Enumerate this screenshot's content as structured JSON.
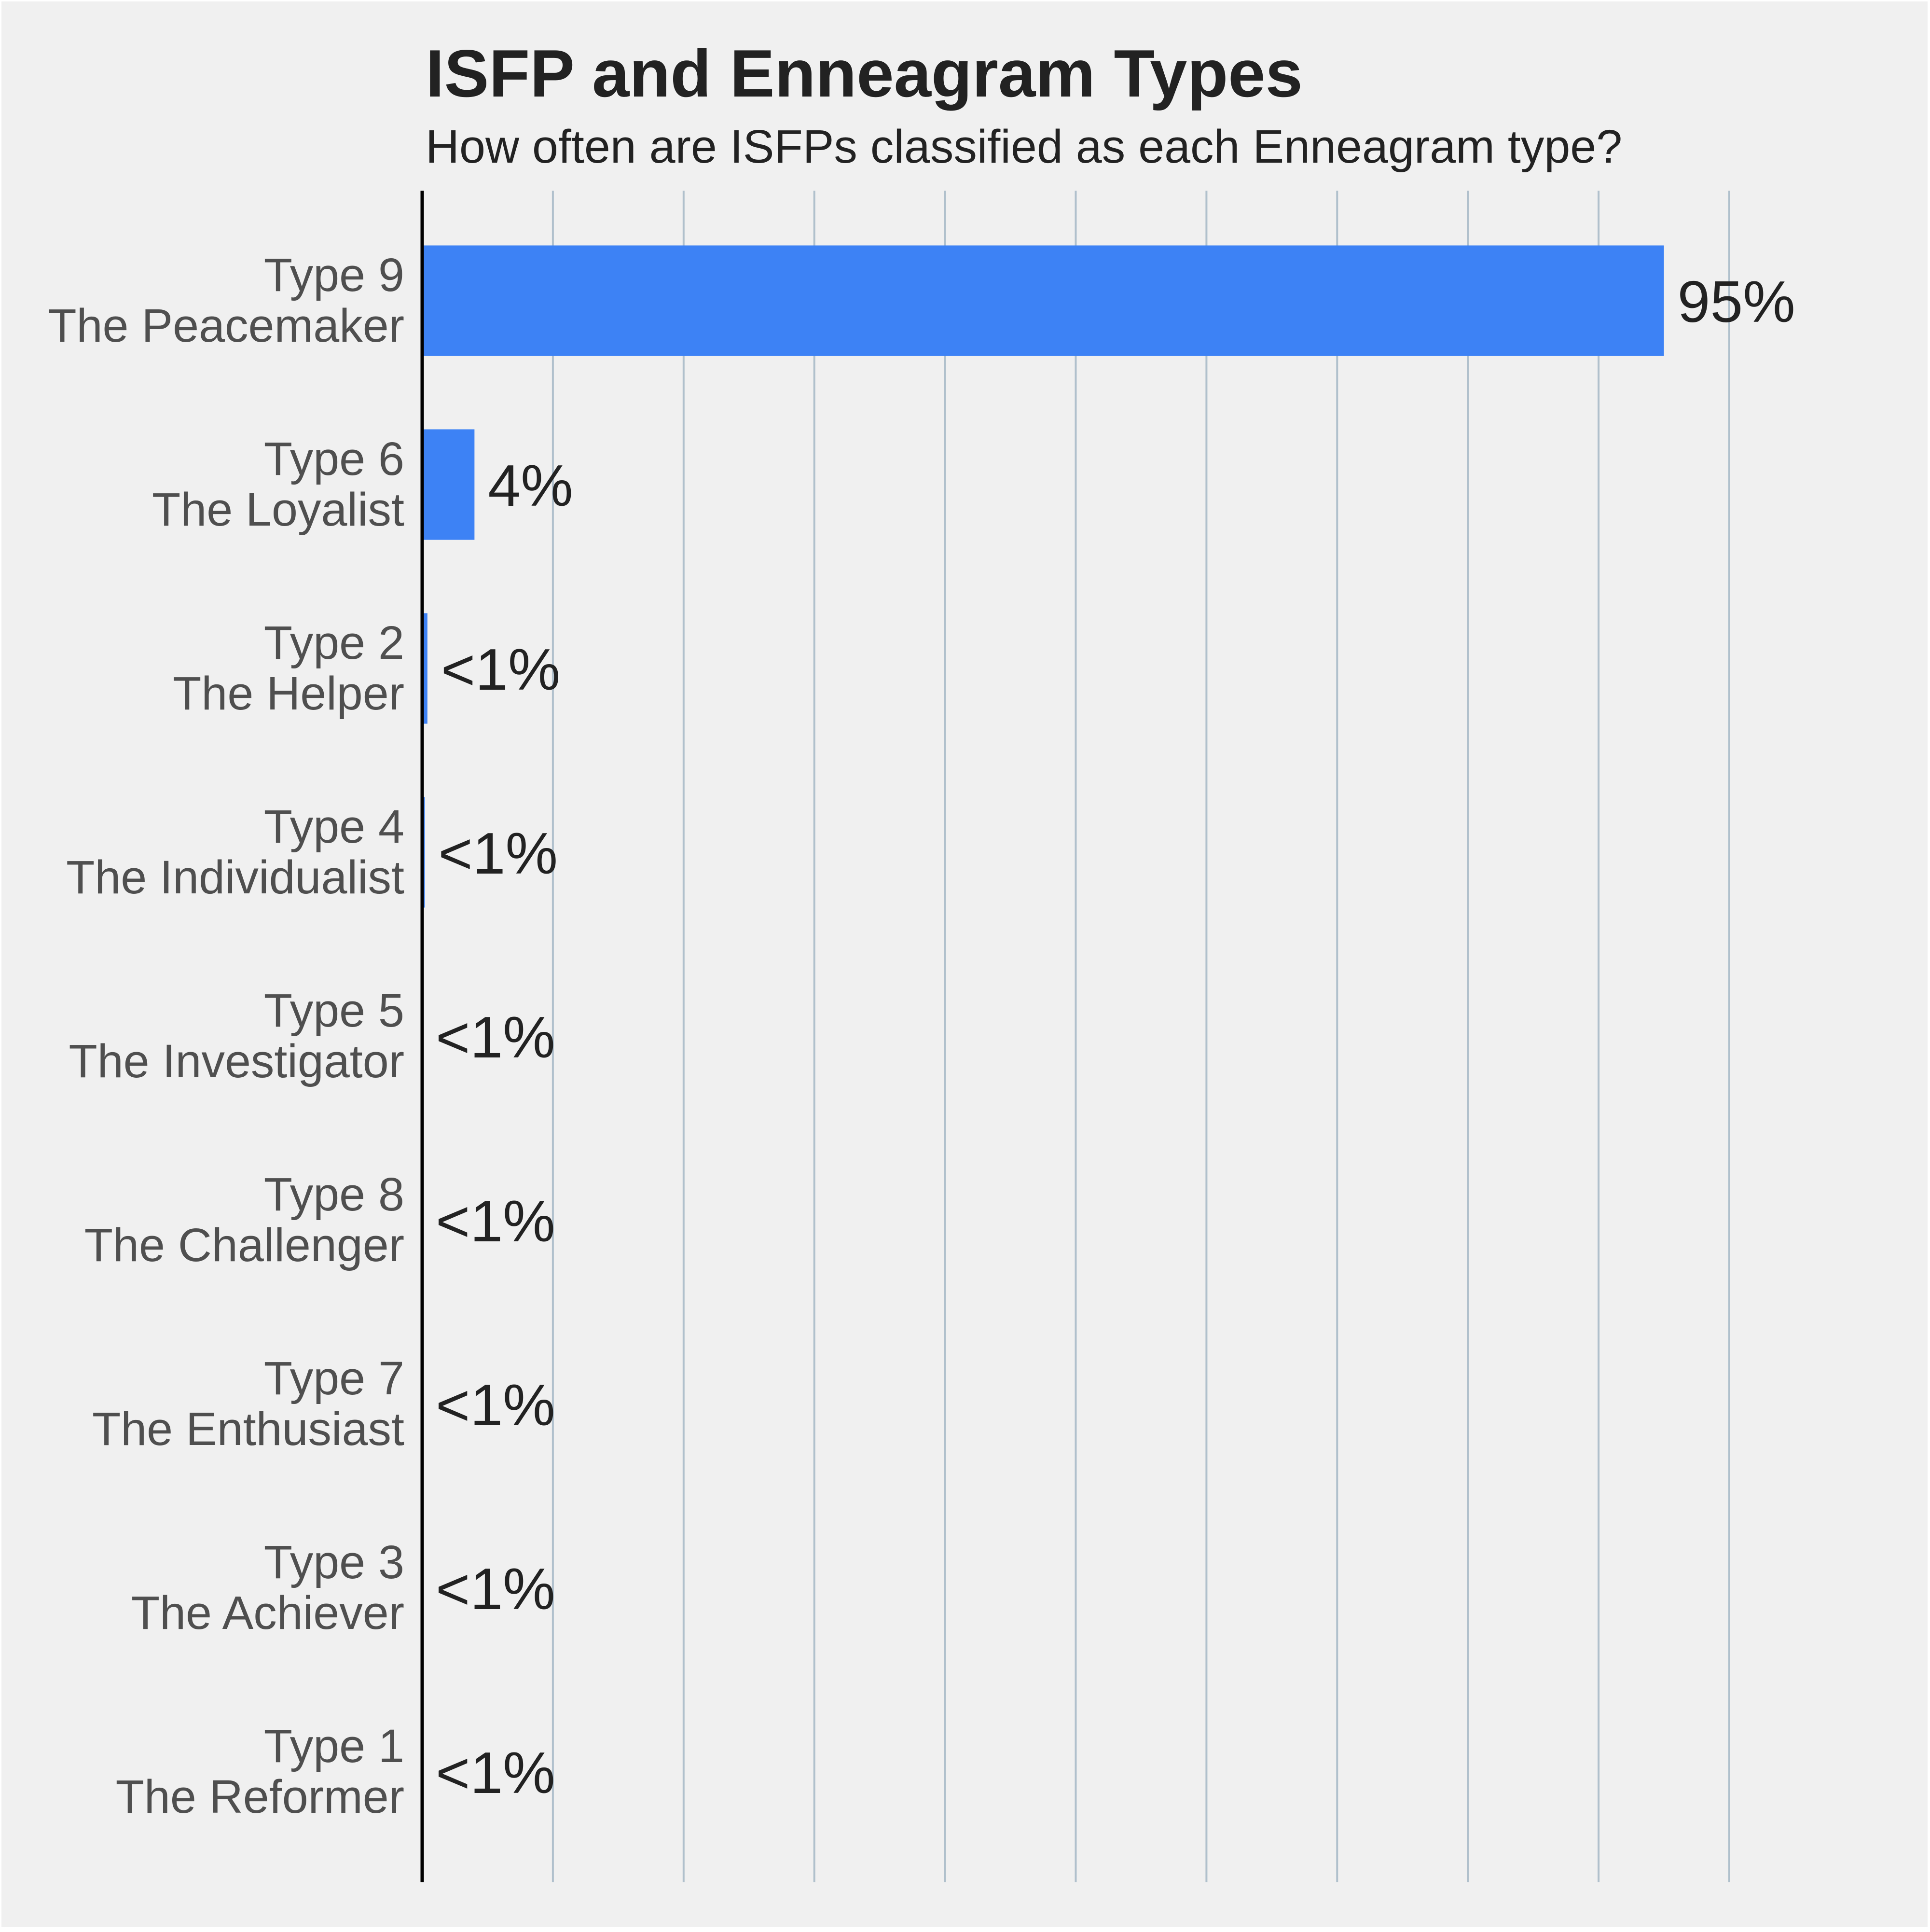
{
  "chart_data": {
    "type": "bar",
    "orientation": "horizontal",
    "title": "ISFP and Enneagram Types",
    "subtitle": "How often are ISFPs classified as each Enneagram type?",
    "xlabel": "",
    "ylabel": "",
    "xlim": [
      0,
      100
    ],
    "x_tick_labels_shown": false,
    "grid": "vertical",
    "grid_interval": 10,
    "bar_color": "#3d82f5",
    "categories": [
      {
        "type": "Type 9",
        "name": "The Peacemaker"
      },
      {
        "type": "Type 6",
        "name": "The Loyalist"
      },
      {
        "type": "Type 2",
        "name": "The Helper"
      },
      {
        "type": "Type 4",
        "name": "The Individualist"
      },
      {
        "type": "Type 5",
        "name": "The Investigator"
      },
      {
        "type": "Type 8",
        "name": "The Challenger"
      },
      {
        "type": "Type 7",
        "name": "The Enthusiast"
      },
      {
        "type": "Type 3",
        "name": "The Achiever"
      },
      {
        "type": "Type 1",
        "name": "The Reformer"
      }
    ],
    "values": [
      95,
      4,
      0.4,
      0.2,
      0,
      0,
      0,
      0,
      0
    ],
    "value_labels": [
      "95%",
      "4%",
      "<1%",
      "<1%",
      "<1%",
      "<1%",
      "<1%",
      "<1%",
      "<1%"
    ]
  }
}
